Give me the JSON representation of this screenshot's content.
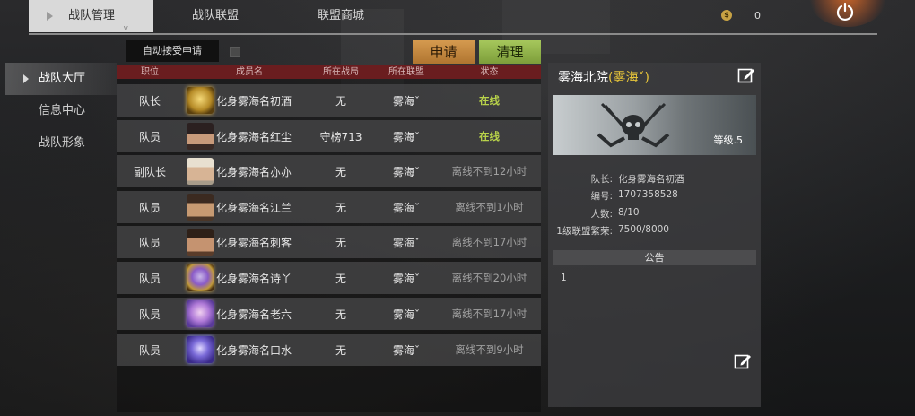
{
  "top_tabs": [
    {
      "label": "战队管理",
      "indicator": "v"
    },
    {
      "label": "战队联盟"
    },
    {
      "label": "联盟商城"
    }
  ],
  "currency": {
    "icon": "coin-icon",
    "value": "0"
  },
  "sidebar": {
    "items": [
      {
        "label": "战队大厅"
      },
      {
        "label": "信息中心"
      },
      {
        "label": "战队形象"
      }
    ]
  },
  "controls": {
    "auto_accept_label": "自动接受申请",
    "apply_label": "申请",
    "clear_label": "清理"
  },
  "table": {
    "headers": [
      "职位",
      "成员名",
      "所在战局",
      "所在联盟",
      "状态"
    ],
    "rows": [
      {
        "position": "队长",
        "name": "化身雾海名初酒",
        "zone": "无",
        "alliance": "雾海ˇ",
        "status": "在线",
        "online": true,
        "avatar": "gold-frame-avatar"
      },
      {
        "position": "队员",
        "name": "化身雾海名红尘",
        "zone": "守榜713",
        "alliance": "雾海ˇ",
        "status": "在线",
        "online": true,
        "avatar": "face-avatar"
      },
      {
        "position": "副队长",
        "name": "化身雾海名亦亦",
        "zone": "无",
        "alliance": "雾海ˇ",
        "status": "离线不到12小时",
        "online": false,
        "avatar": "face-avatar"
      },
      {
        "position": "队员",
        "name": "化身雾海名江兰",
        "zone": "无",
        "alliance": "雾海ˇ",
        "status": "离线不到1小时",
        "online": false,
        "avatar": "face-avatar"
      },
      {
        "position": "队员",
        "name": "化身雾海名刺客",
        "zone": "无",
        "alliance": "雾海ˇ",
        "status": "离线不到17小时",
        "online": false,
        "avatar": "face-avatar"
      },
      {
        "position": "队员",
        "name": "化身雾海名诗丫",
        "zone": "无",
        "alliance": "雾海ˇ",
        "status": "离线不到20小时",
        "online": false,
        "avatar": "gold-frame-avatar"
      },
      {
        "position": "队员",
        "name": "化身雾海名老六",
        "zone": "无",
        "alliance": "雾海ˇ",
        "status": "离线不到17小时",
        "online": false,
        "avatar": "purple-frame-avatar"
      },
      {
        "position": "队员",
        "name": "化身雾海名口水",
        "zone": "无",
        "alliance": "雾海ˇ",
        "status": "离线不到9小时",
        "online": false,
        "avatar": "blue-frame-avatar"
      }
    ]
  },
  "team_panel": {
    "name": "雾海北院",
    "tag": "(雾海ˇ)",
    "level": "等级.5",
    "emblem": "skull-emblem-icon",
    "info": [
      {
        "key": "队长:",
        "value": "化身雾海名初酒"
      },
      {
        "key": "编号:",
        "value": "1707358528"
      },
      {
        "key": "人数:",
        "value": "8/10"
      },
      {
        "key": "1级联盟繁荣:",
        "value": "7500/8000"
      }
    ],
    "notice_title": "公告",
    "notice_text": "1"
  },
  "colors": {
    "accent_tab_bg": "#d9d9d9",
    "apply_btn": "#c88a40",
    "clear_btn": "#94b84c",
    "header_red": "#6a1d1f",
    "online_green": "#b8d24a",
    "alliance_gold": "#e6c43a"
  }
}
